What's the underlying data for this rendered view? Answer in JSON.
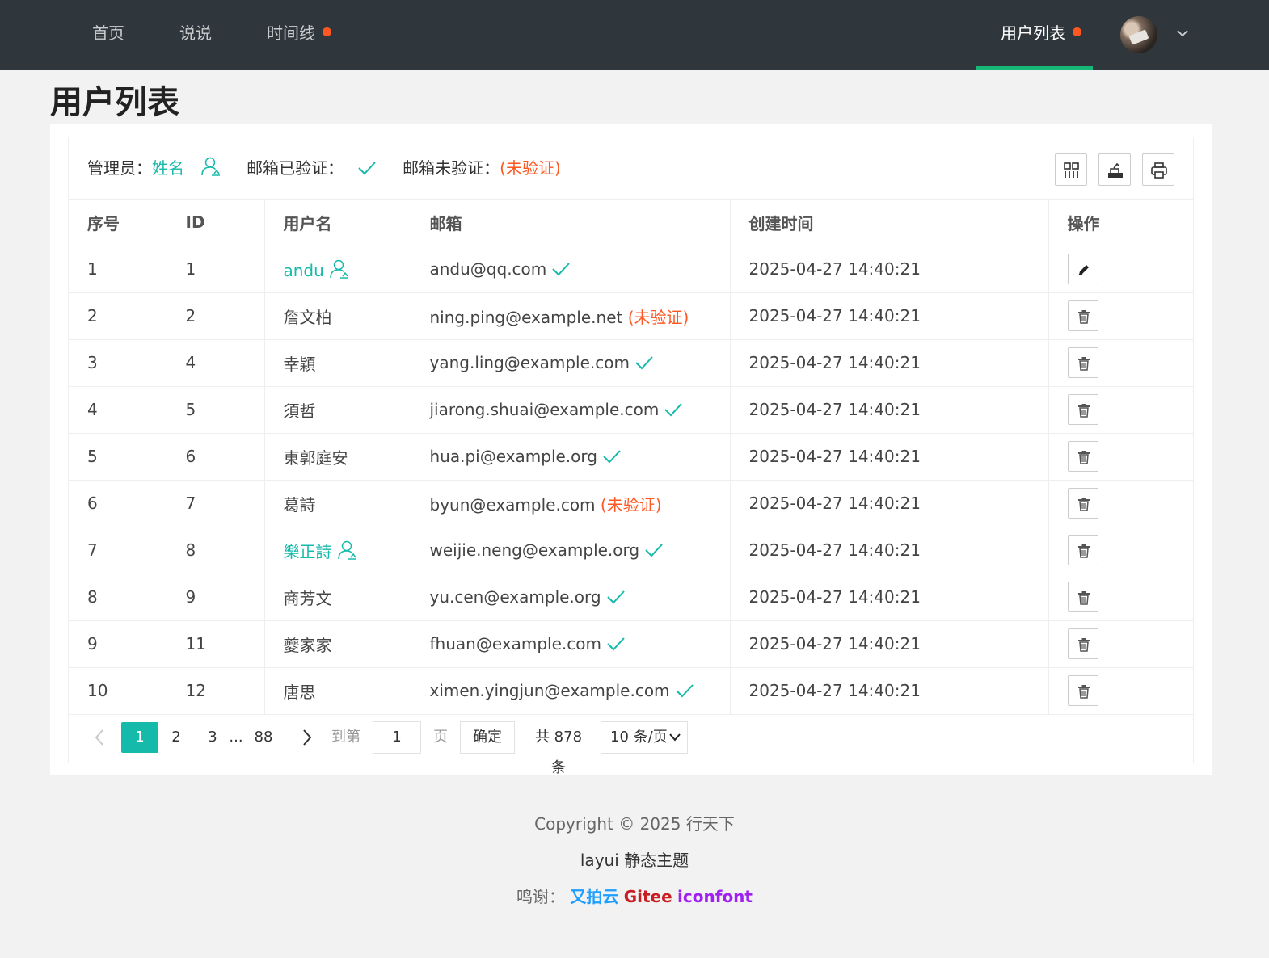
{
  "nav": {
    "left": [
      {
        "label": "首页"
      },
      {
        "label": "说说"
      },
      {
        "label": "时间线",
        "dot": true
      }
    ],
    "right": {
      "label": "用户列表",
      "dot": true
    },
    "accent": "#16b777",
    "dot_color": "#ff5722"
  },
  "page_title": "用户列表",
  "legend": {
    "admin_label": "管理员：",
    "admin_sample": "姓名",
    "verified_label": "邮箱已验证：",
    "unverified_label": "邮箱未验证：",
    "unverified_sample": "(未验证)"
  },
  "toolbar_icons": [
    "columns-icon",
    "export-icon",
    "print-icon"
  ],
  "table": {
    "headers": [
      "序号",
      "ID",
      "用户名",
      "邮箱",
      "创建时间",
      "操作"
    ],
    "rows": [
      {
        "no": "1",
        "id": "1",
        "name": "andu",
        "admin": true,
        "email": "andu@qq.com",
        "verified": true,
        "created": "2025-04-27 14:40:21",
        "action": "edit"
      },
      {
        "no": "2",
        "id": "2",
        "name": "詹文柏",
        "admin": false,
        "email": "ning.ping@example.net",
        "verified": false,
        "created": "2025-04-27 14:40:21",
        "action": "delete"
      },
      {
        "no": "3",
        "id": "4",
        "name": "幸穎",
        "admin": false,
        "email": "yang.ling@example.com",
        "verified": true,
        "created": "2025-04-27 14:40:21",
        "action": "delete"
      },
      {
        "no": "4",
        "id": "5",
        "name": "須哲",
        "admin": false,
        "email": "jiarong.shuai@example.com",
        "verified": true,
        "created": "2025-04-27 14:40:21",
        "action": "delete"
      },
      {
        "no": "5",
        "id": "6",
        "name": "東郭庭安",
        "admin": false,
        "email": "hua.pi@example.org",
        "verified": true,
        "created": "2025-04-27 14:40:21",
        "action": "delete"
      },
      {
        "no": "6",
        "id": "7",
        "name": "葛詩",
        "admin": false,
        "email": "byun@example.com",
        "verified": false,
        "created": "2025-04-27 14:40:21",
        "action": "delete"
      },
      {
        "no": "7",
        "id": "8",
        "name": "樂正詩",
        "admin": true,
        "email": "weijie.neng@example.org",
        "verified": true,
        "created": "2025-04-27 14:40:21",
        "action": "delete"
      },
      {
        "no": "8",
        "id": "9",
        "name": "商芳文",
        "admin": false,
        "email": "yu.cen@example.org",
        "verified": true,
        "created": "2025-04-27 14:40:21",
        "action": "delete"
      },
      {
        "no": "9",
        "id": "11",
        "name": "夔家家",
        "admin": false,
        "email": "fhuan@example.com",
        "verified": true,
        "created": "2025-04-27 14:40:21",
        "action": "delete"
      },
      {
        "no": "10",
        "id": "12",
        "name": "唐思",
        "admin": false,
        "email": "ximen.yingjun@example.com",
        "verified": true,
        "created": "2025-04-27 14:40:21",
        "action": "delete"
      }
    ],
    "unverified_text": "(未验证)"
  },
  "pager": {
    "current": "1",
    "pages": [
      "2",
      "3"
    ],
    "ellipsis": "...",
    "last": "88",
    "goto_label": "到第",
    "goto_value": "1",
    "page_unit": "页",
    "confirm": "确定",
    "total": "共 878 条",
    "page_size": "10 条/页"
  },
  "footer": {
    "copyright": "Copyright © 2025 行天下",
    "theme": "layui 静态主题",
    "thanks_label": "鸣谢：",
    "links": [
      {
        "label": "又拍云",
        "color": "#1e9fff"
      },
      {
        "label": "Gitee",
        "color": "#c71d23"
      },
      {
        "label": "iconfont",
        "color": "#a020f0"
      }
    ]
  },
  "colors": {
    "teal": "#16baaa",
    "warn": "#ff5722",
    "topbar": "#2f363c"
  }
}
